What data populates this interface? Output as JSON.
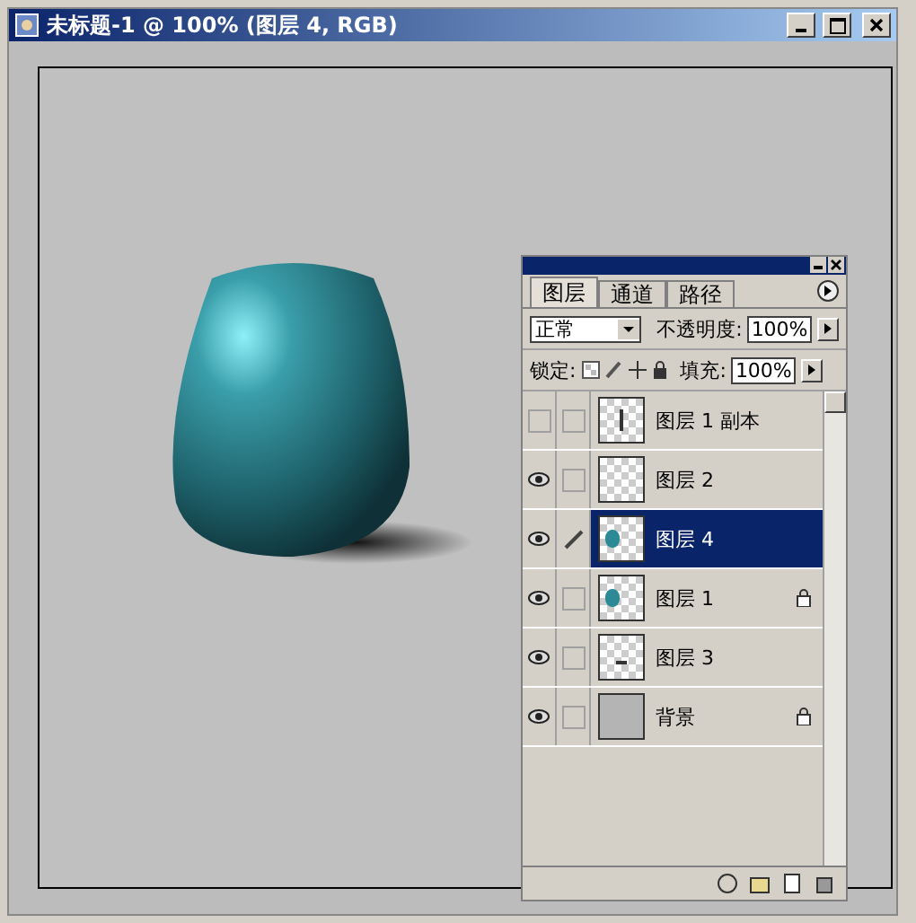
{
  "window": {
    "title": "未标题-1 @ 100% (图层 4, RGB)"
  },
  "layers_panel": {
    "tabs": [
      {
        "label": "图层",
        "selected": true
      },
      {
        "label": "通道",
        "selected": false
      },
      {
        "label": "路径",
        "selected": false
      }
    ],
    "blend_mode": "正常",
    "opacity_label": "不透明度:",
    "opacity": "100%",
    "lock_label": "锁定:",
    "fill_label": "填充:",
    "fill": "100%",
    "layers": [
      {
        "name": "图层 1 副本",
        "visible": false,
        "editing": false,
        "selected": false,
        "locked": false,
        "kind": "vertical-mark"
      },
      {
        "name": "图层 2",
        "visible": true,
        "editing": false,
        "selected": false,
        "locked": false,
        "kind": "empty"
      },
      {
        "name": "图层 4",
        "visible": true,
        "editing": true,
        "selected": true,
        "locked": false,
        "kind": "vase"
      },
      {
        "name": "图层 1",
        "visible": true,
        "editing": false,
        "selected": false,
        "locked": true,
        "kind": "vase"
      },
      {
        "name": "图层 3",
        "visible": true,
        "editing": false,
        "selected": false,
        "locked": false,
        "kind": "horizontal-mark"
      },
      {
        "name": "背景",
        "visible": true,
        "editing": false,
        "selected": false,
        "locked": true,
        "kind": "solid"
      }
    ]
  }
}
